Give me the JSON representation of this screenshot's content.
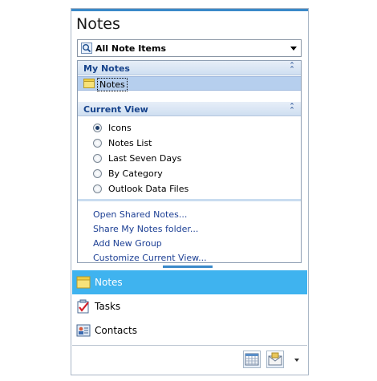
{
  "title": "Notes",
  "folder_dropdown": {
    "label": "All Note Items"
  },
  "my_notes": {
    "header": "My Notes",
    "items": [
      {
        "label": "Notes",
        "selected": true
      }
    ]
  },
  "current_view": {
    "header": "Current View",
    "options": [
      {
        "label": "Icons",
        "selected": true
      },
      {
        "label": "Notes List",
        "selected": false
      },
      {
        "label": "Last Seven Days",
        "selected": false
      },
      {
        "label": "By Category",
        "selected": false
      },
      {
        "label": "Outlook Data Files",
        "selected": false
      }
    ]
  },
  "links": [
    "Open Shared Notes...",
    "Share My Notes folder...",
    "Add New Group",
    "Customize Current View..."
  ],
  "nav_buttons": [
    {
      "label": "Notes",
      "icon": "note-icon",
      "active": true
    },
    {
      "label": "Tasks",
      "icon": "tasks-icon",
      "active": false
    },
    {
      "label": "Contacts",
      "icon": "contacts-icon",
      "active": false
    }
  ],
  "bottom_icons": [
    "calendar-icon",
    "mail-icon",
    "chevron-down-icon"
  ],
  "colors": {
    "accent": "#3a89c9",
    "active_nav": "#3fb3ef",
    "section_text": "#15428b",
    "link": "#1c3f94"
  }
}
